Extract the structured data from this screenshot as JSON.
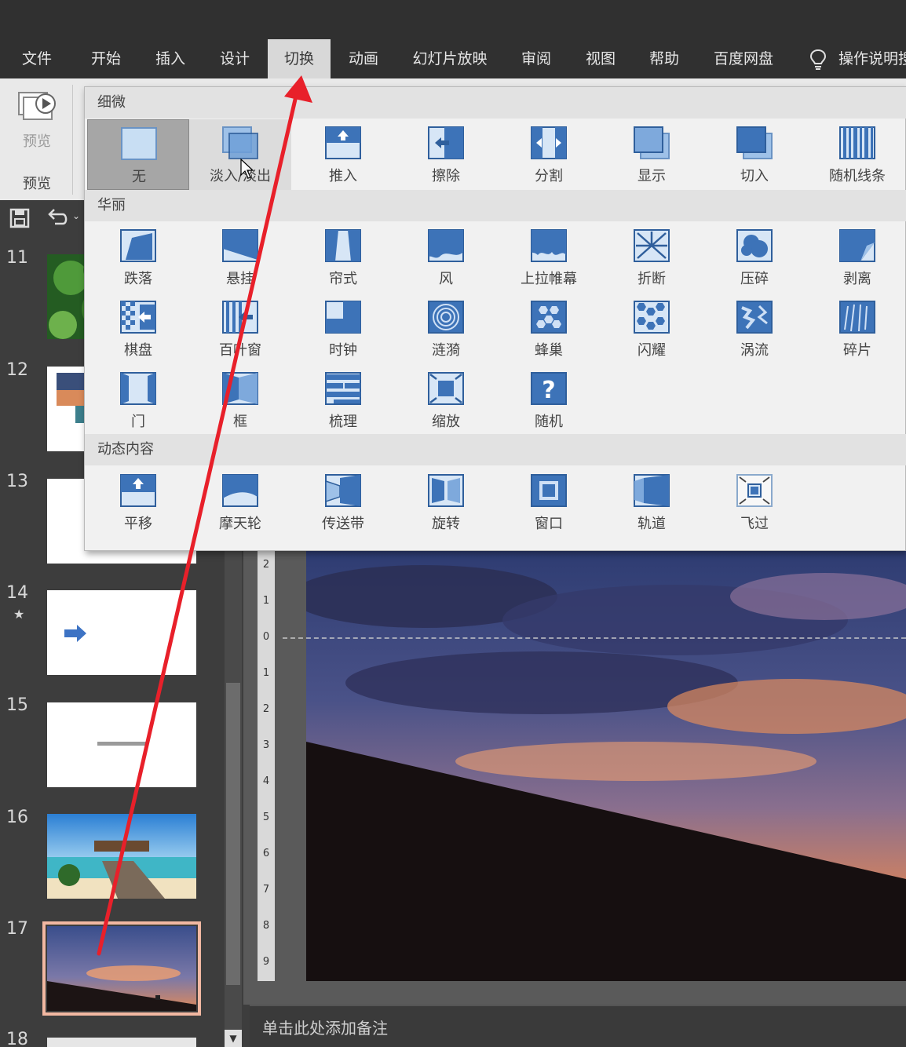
{
  "menu": {
    "tabs": [
      {
        "label": "文件"
      },
      {
        "label": "开始"
      },
      {
        "label": "插入"
      },
      {
        "label": "设计"
      },
      {
        "label": "切换",
        "active": true
      },
      {
        "label": "动画"
      },
      {
        "label": "幻灯片放映"
      },
      {
        "label": "审阅"
      },
      {
        "label": "视图"
      },
      {
        "label": "帮助"
      },
      {
        "label": "百度网盘"
      }
    ],
    "tell_me": "操作说明搜"
  },
  "ribbon": {
    "preview_button_label": "预览",
    "group_label": "预览"
  },
  "gallery": {
    "sections": [
      {
        "title": "细微",
        "items": [
          {
            "label": "无",
            "icon": "none-transition-icon",
            "state": "selected"
          },
          {
            "label": "淡入/淡出",
            "icon": "fade-transition-icon",
            "state": "hover"
          },
          {
            "label": "推入",
            "icon": "push-transition-icon"
          },
          {
            "label": "擦除",
            "icon": "wipe-transition-icon"
          },
          {
            "label": "分割",
            "icon": "split-transition-icon"
          },
          {
            "label": "显示",
            "icon": "reveal-transition-icon"
          },
          {
            "label": "切入",
            "icon": "cut-transition-icon"
          },
          {
            "label": "随机线条",
            "icon": "random-bars-transition-icon"
          }
        ]
      },
      {
        "title": "华丽",
        "items": [
          {
            "label": "跌落",
            "icon": "fall-over-transition-icon"
          },
          {
            "label": "悬挂",
            "icon": "drape-transition-icon"
          },
          {
            "label": "帘式",
            "icon": "curtains-transition-icon"
          },
          {
            "label": "风",
            "icon": "wind-transition-icon"
          },
          {
            "label": "上拉帷幕",
            "icon": "prestige-transition-icon"
          },
          {
            "label": "折断",
            "icon": "fracture-transition-icon"
          },
          {
            "label": "压碎",
            "icon": "crush-transition-icon"
          },
          {
            "label": "剥离",
            "icon": "peel-off-transition-icon"
          },
          {
            "label": "棋盘",
            "icon": "checkerboard-transition-icon"
          },
          {
            "label": "百叶窗",
            "icon": "blinds-transition-icon"
          },
          {
            "label": "时钟",
            "icon": "clock-transition-icon"
          },
          {
            "label": "涟漪",
            "icon": "ripple-transition-icon"
          },
          {
            "label": "蜂巢",
            "icon": "honeycomb-transition-icon"
          },
          {
            "label": "闪耀",
            "icon": "glitter-transition-icon"
          },
          {
            "label": "涡流",
            "icon": "vortex-transition-icon"
          },
          {
            "label": "碎片",
            "icon": "shred-transition-icon"
          },
          {
            "label": "门",
            "icon": "doors-transition-icon"
          },
          {
            "label": "框",
            "icon": "box-transition-icon"
          },
          {
            "label": "梳理",
            "icon": "comb-transition-icon"
          },
          {
            "label": "缩放",
            "icon": "zoom-transition-icon"
          },
          {
            "label": "随机",
            "icon": "random-transition-icon"
          }
        ]
      },
      {
        "title": "动态内容",
        "items": [
          {
            "label": "平移",
            "icon": "pan-transition-icon"
          },
          {
            "label": "摩天轮",
            "icon": "ferris-wheel-transition-icon"
          },
          {
            "label": "传送带",
            "icon": "conveyor-transition-icon"
          },
          {
            "label": "旋转",
            "icon": "rotate-transition-icon"
          },
          {
            "label": "窗口",
            "icon": "window-transition-icon"
          },
          {
            "label": "轨道",
            "icon": "orbit-transition-icon"
          },
          {
            "label": "飞过",
            "icon": "fly-through-transition-icon"
          }
        ]
      }
    ]
  },
  "slides": [
    {
      "number": "11"
    },
    {
      "number": "12"
    },
    {
      "number": "13"
    },
    {
      "number": "14",
      "marker": "★"
    },
    {
      "number": "15"
    },
    {
      "number": "16"
    },
    {
      "number": "17",
      "selected": true
    },
    {
      "number": "18"
    }
  ],
  "ruler": {
    "ticks": [
      "2",
      "1",
      "0",
      "1",
      "2",
      "3",
      "4",
      "5",
      "6",
      "7",
      "8",
      "9"
    ]
  },
  "notes": {
    "placeholder": "单击此处添加备注"
  },
  "colors": {
    "annotation_arrow": "#e8202a",
    "selected_slide_border": "#f2b8a2",
    "active_tab_bg": "#d8d8d8"
  }
}
